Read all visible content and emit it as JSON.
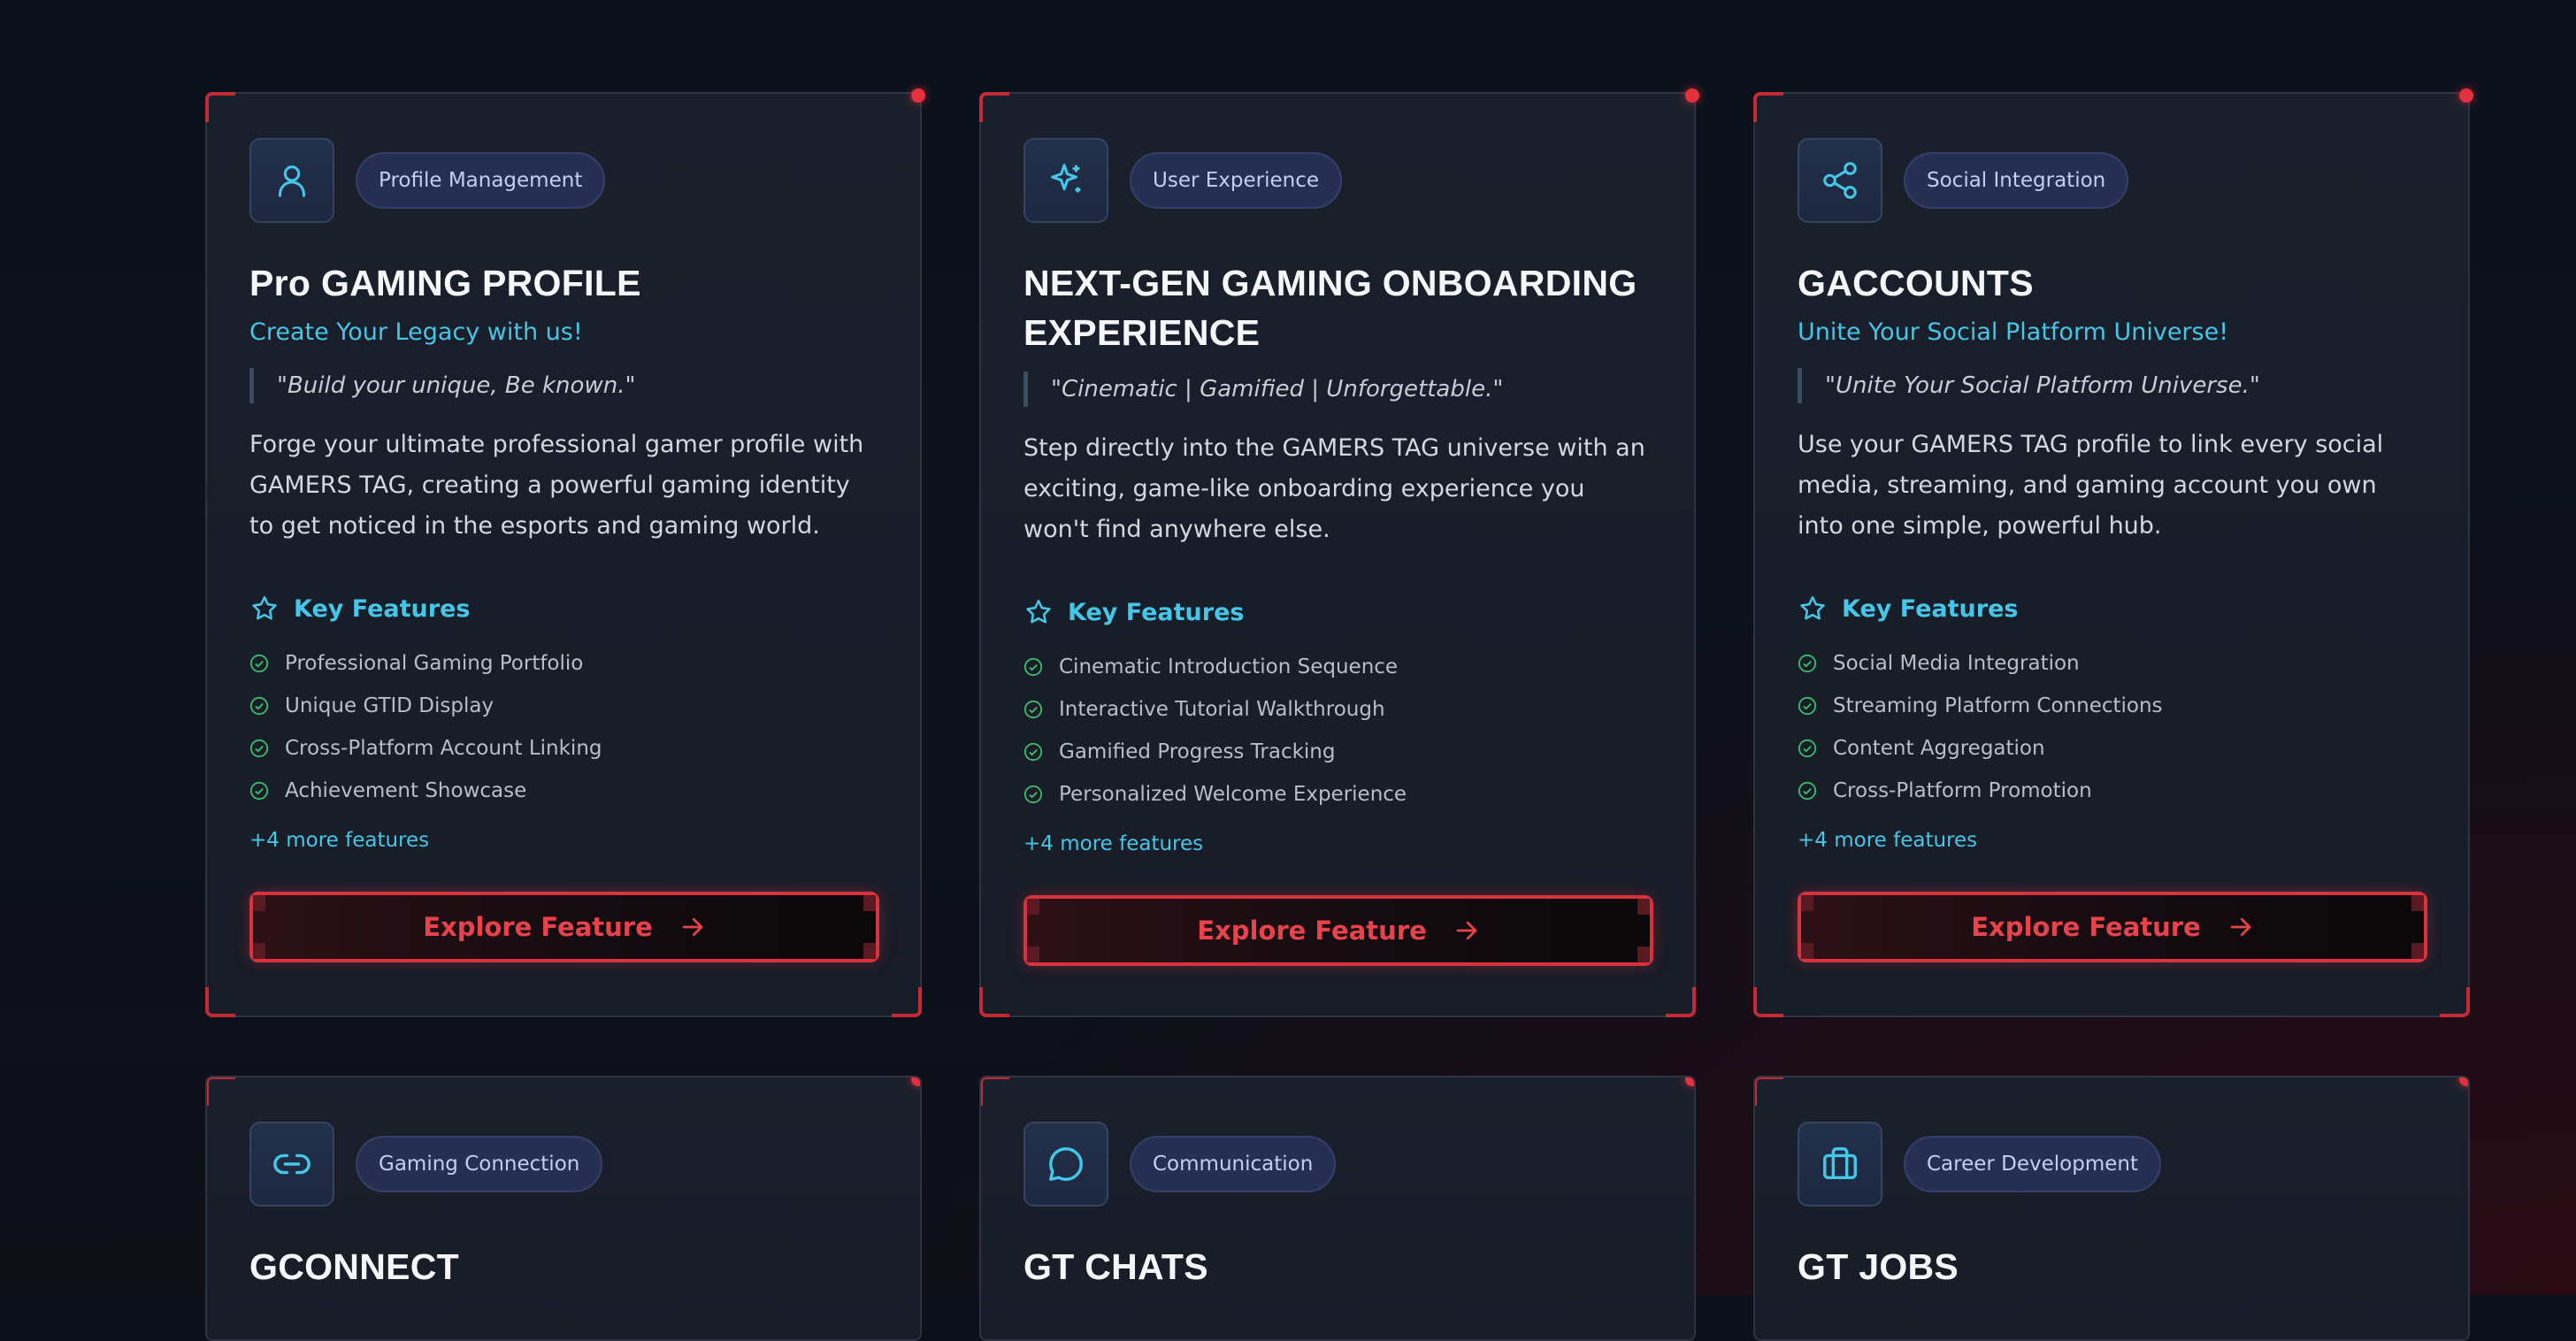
{
  "colors": {
    "accent_cyan": "#45c6e6",
    "accent_red": "#e3303f",
    "check_green": "#3dbb6b",
    "background": "#0c111b"
  },
  "cards": [
    {
      "icon": "user-icon",
      "badge": "Profile Management",
      "title": "Pro GAMING PROFILE",
      "subtitle": "Create Your Legacy with us!",
      "quote": "\"Build your unique, Be known.\"",
      "description": "Forge your ultimate professional gamer profile with GAMERS TAG, creating a powerful gaming identity to get noticed in the esports and gaming world.",
      "key_features_label": "Key Features",
      "features": [
        "Professional Gaming Portfolio",
        "Unique GTID Display",
        "Cross-Platform Account Linking",
        "Achievement Showcase"
      ],
      "more": "+4 more features",
      "button": "Explore Feature"
    },
    {
      "icon": "sparkles-icon",
      "badge": "User Experience",
      "title": "NEXT-GEN GAMING ONBOARDING EXPERIENCE",
      "subtitle": "",
      "quote": "\"Cinematic | Gamified | Unforgettable.\"",
      "description": "Step directly into the GAMERS TAG universe with an exciting, game-like onboarding experience you won't find anywhere else.",
      "key_features_label": "Key Features",
      "features": [
        "Cinematic Introduction Sequence",
        "Interactive Tutorial Walkthrough",
        "Gamified Progress Tracking",
        "Personalized Welcome Experience"
      ],
      "more": "+4 more features",
      "button": "Explore Feature"
    },
    {
      "icon": "share-icon",
      "badge": "Social Integration",
      "title": "GACCOUNTS",
      "subtitle": "Unite Your Social Platform Universe!",
      "quote": "\"Unite Your Social Platform Universe.\"",
      "description": "Use your GAMERS TAG profile to link every social media, streaming, and gaming account you own into one simple, powerful hub.",
      "key_features_label": "Key Features",
      "features": [
        "Social Media Integration",
        "Streaming Platform Connections",
        "Content Aggregation",
        "Cross-Platform Promotion"
      ],
      "more": "+4 more features",
      "button": "Explore Feature"
    },
    {
      "icon": "link-icon",
      "badge": "Gaming Connection",
      "title": "GCONNECT"
    },
    {
      "icon": "chat-bubble-icon",
      "badge": "Communication",
      "title": "GT CHATS"
    },
    {
      "icon": "briefcase-icon",
      "badge": "Career Development",
      "title": "GT JOBS"
    }
  ]
}
